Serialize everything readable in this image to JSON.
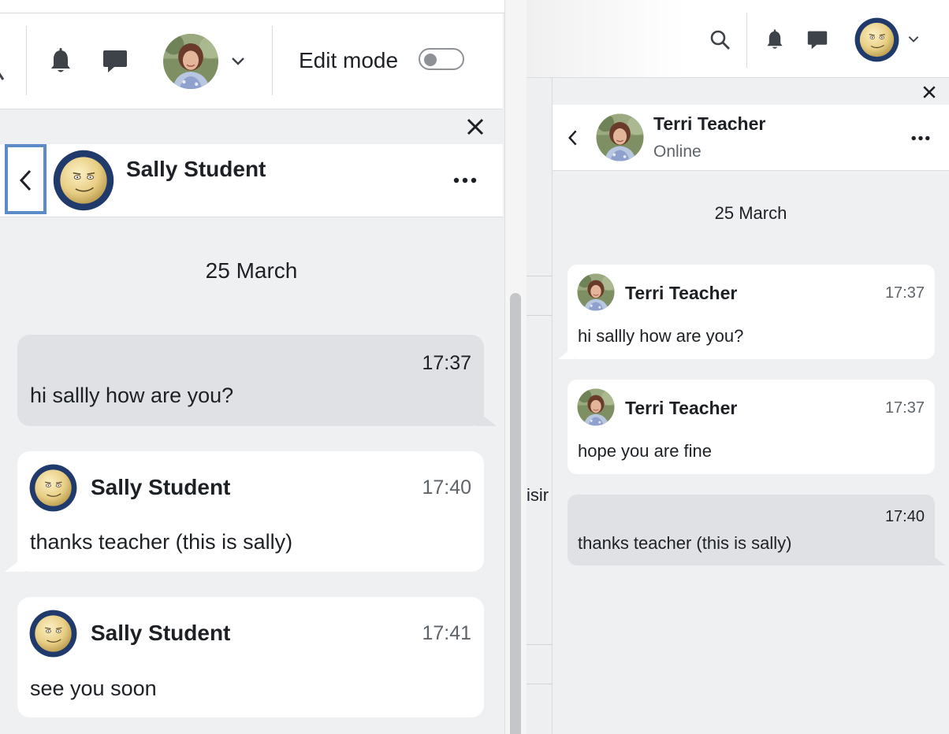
{
  "left": {
    "navbar": {
      "icons": [
        "notification-bell-icon",
        "messages-icon",
        "chevron-down-icon"
      ],
      "edit_mode_label": "Edit mode",
      "edit_mode_on": false
    },
    "chat": {
      "contact_name": "Sally Student",
      "date_label": "25 March",
      "messages": [
        {
          "own": true,
          "time": "17:37",
          "text": "hi sallly how are you?"
        },
        {
          "own": false,
          "sender": "Sally Student",
          "time": "17:40",
          "text": "thanks teacher (this is sally)"
        },
        {
          "own": false,
          "sender": "Sally Student",
          "time": "17:41",
          "text": "see you soon"
        }
      ]
    }
  },
  "right": {
    "navbar": {
      "icons": [
        "search-icon",
        "notification-bell-icon",
        "messages-icon",
        "chevron-down-icon"
      ]
    },
    "background_fragment": "isir",
    "chat": {
      "contact_name": "Terri Teacher",
      "status": "Online",
      "date_label": "25 March",
      "messages": [
        {
          "own": false,
          "sender": "Terri Teacher",
          "time": "17:37",
          "text": "hi sallly how are you?"
        },
        {
          "own": false,
          "sender": "Terri Teacher",
          "time": "17:37",
          "text": "hope you are fine"
        },
        {
          "own": true,
          "time": "17:40",
          "text": "thanks teacher (this is sally)"
        }
      ]
    }
  },
  "colors": {
    "focus_ring": "#5b8cc8",
    "own_bubble": "#dfe1e5",
    "other_bubble": "#ffffff",
    "avatar_ring": "#1f3a6b",
    "avatar_face": "#e9cf86"
  }
}
